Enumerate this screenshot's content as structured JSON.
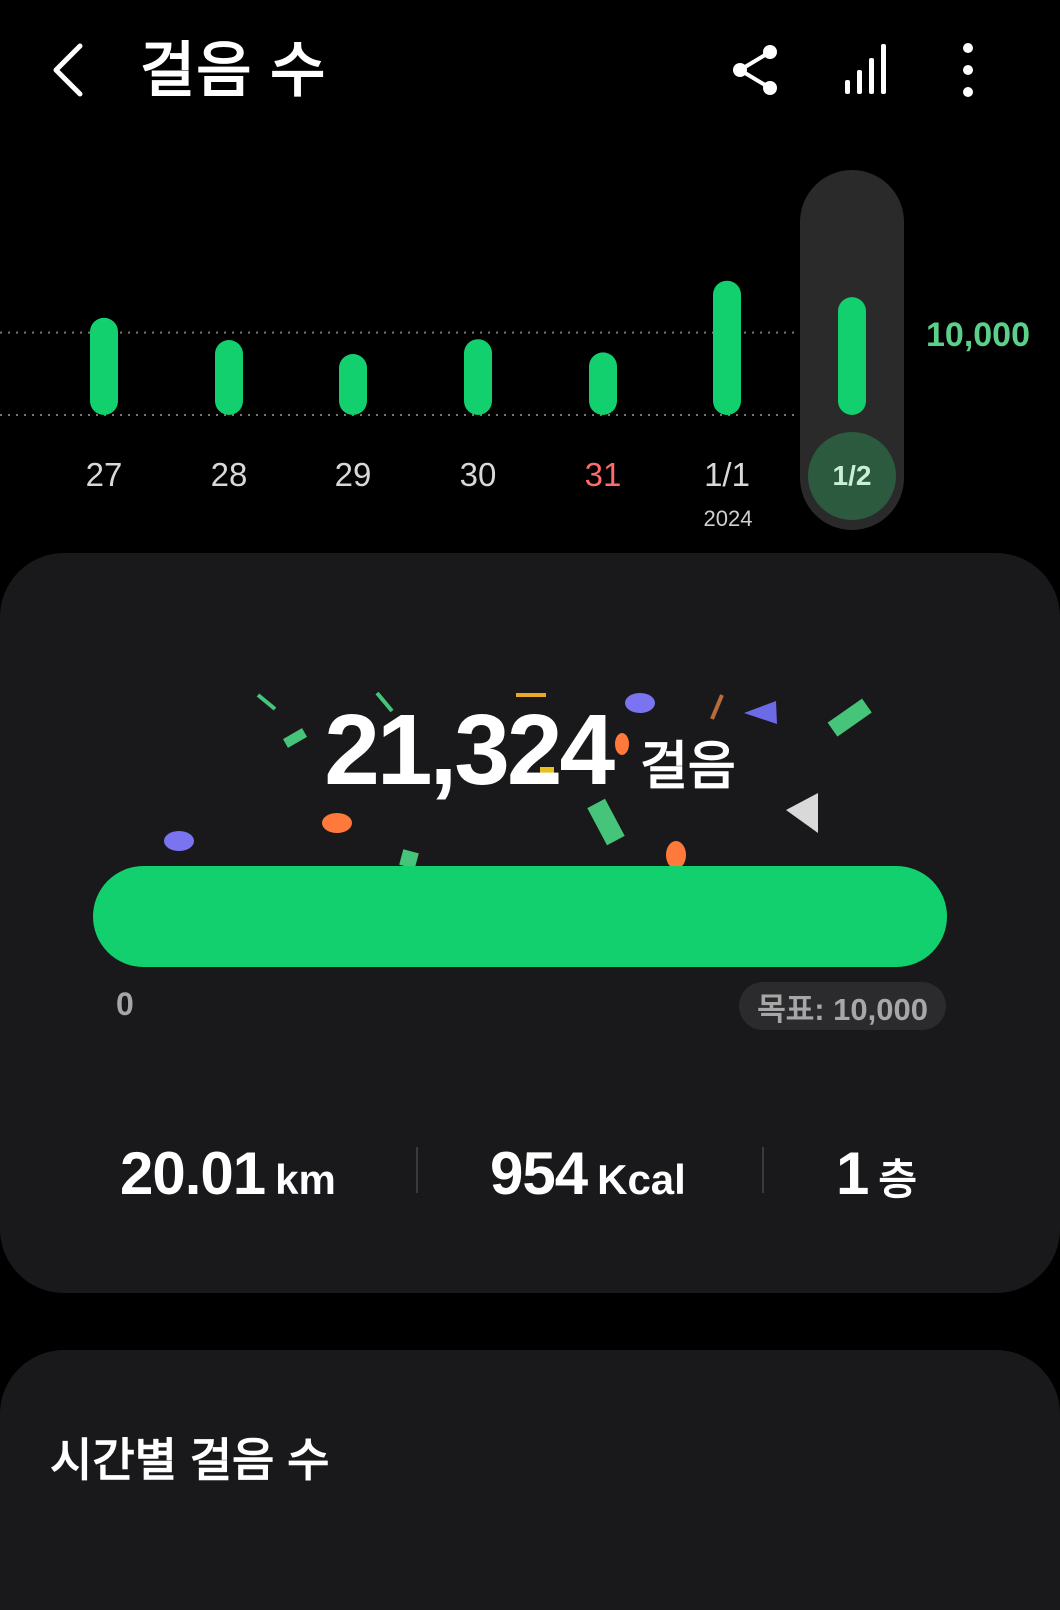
{
  "header": {
    "title": "걸음 수"
  },
  "chart_data": {
    "type": "bar",
    "categories": [
      "27",
      "28",
      "29",
      "30",
      "31",
      "1/1",
      "1/2"
    ],
    "values": [
      11800,
      9100,
      7400,
      9200,
      7600,
      16300,
      14300
    ],
    "reference_line": 10000,
    "reference_label": "10,000",
    "year_label": "2024",
    "selected": "1/2",
    "highlight_category": "31",
    "highlight_color": "#ff6b6b",
    "bar_color": "#12d06e"
  },
  "summary": {
    "steps": "21,324",
    "steps_unit": "걸음",
    "progress_start": "0",
    "goal_label": "목표: 10,000",
    "progress_fraction": 1.0
  },
  "stats": [
    {
      "value": "20.01",
      "unit": "km"
    },
    {
      "value": "954",
      "unit": "Kcal"
    },
    {
      "value": "1",
      "unit": "층"
    }
  ],
  "section": {
    "title": "시간별 걸음 수"
  },
  "colors": {
    "accent": "#12d06e",
    "card": "#19191b",
    "background": "#000000"
  }
}
